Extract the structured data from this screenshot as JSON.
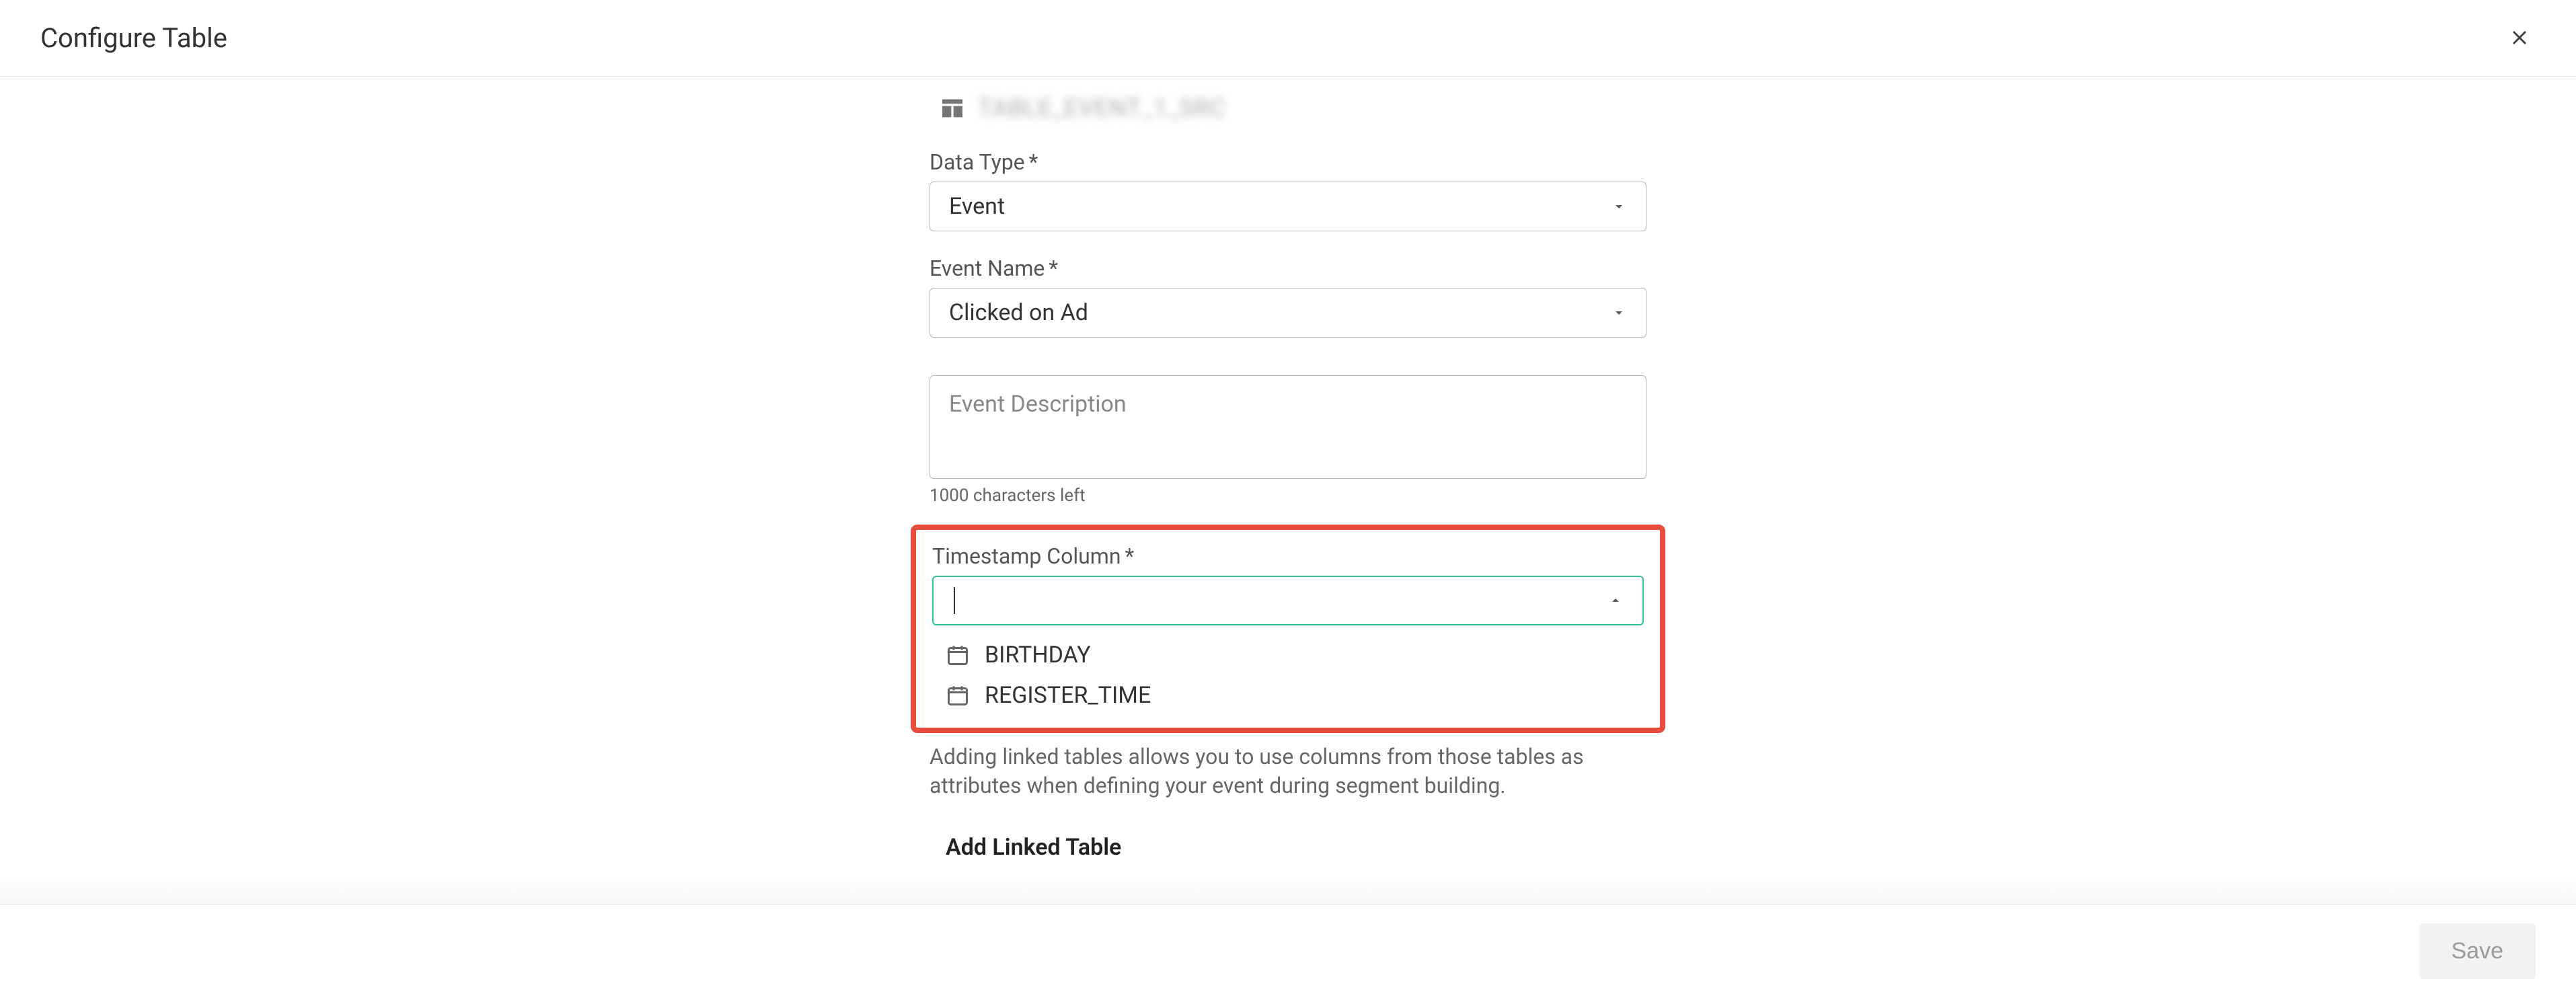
{
  "header": {
    "title": "Configure Table"
  },
  "table": {
    "name_blurred": "TABLE_EVENT_1_SRC"
  },
  "fields": {
    "data_type": {
      "label": "Data Type",
      "required_mark": "*",
      "value": "Event"
    },
    "event_name": {
      "label": "Event Name",
      "required_mark": "*",
      "value": "Clicked on Ad"
    },
    "event_description": {
      "placeholder": "Event Description",
      "value": "",
      "chars_left": "1000 characters left"
    },
    "timestamp_column": {
      "label": "Timestamp Column",
      "required_mark": "*",
      "value": "",
      "options": [
        {
          "label": "BIRTHDAY"
        },
        {
          "label": "REGISTER_TIME"
        }
      ]
    }
  },
  "linked": {
    "help": "Adding linked tables allows you to use columns from those tables as attributes when defining your event during segment building.",
    "add_label": "Add Linked Table"
  },
  "footer": {
    "save": "Save"
  }
}
